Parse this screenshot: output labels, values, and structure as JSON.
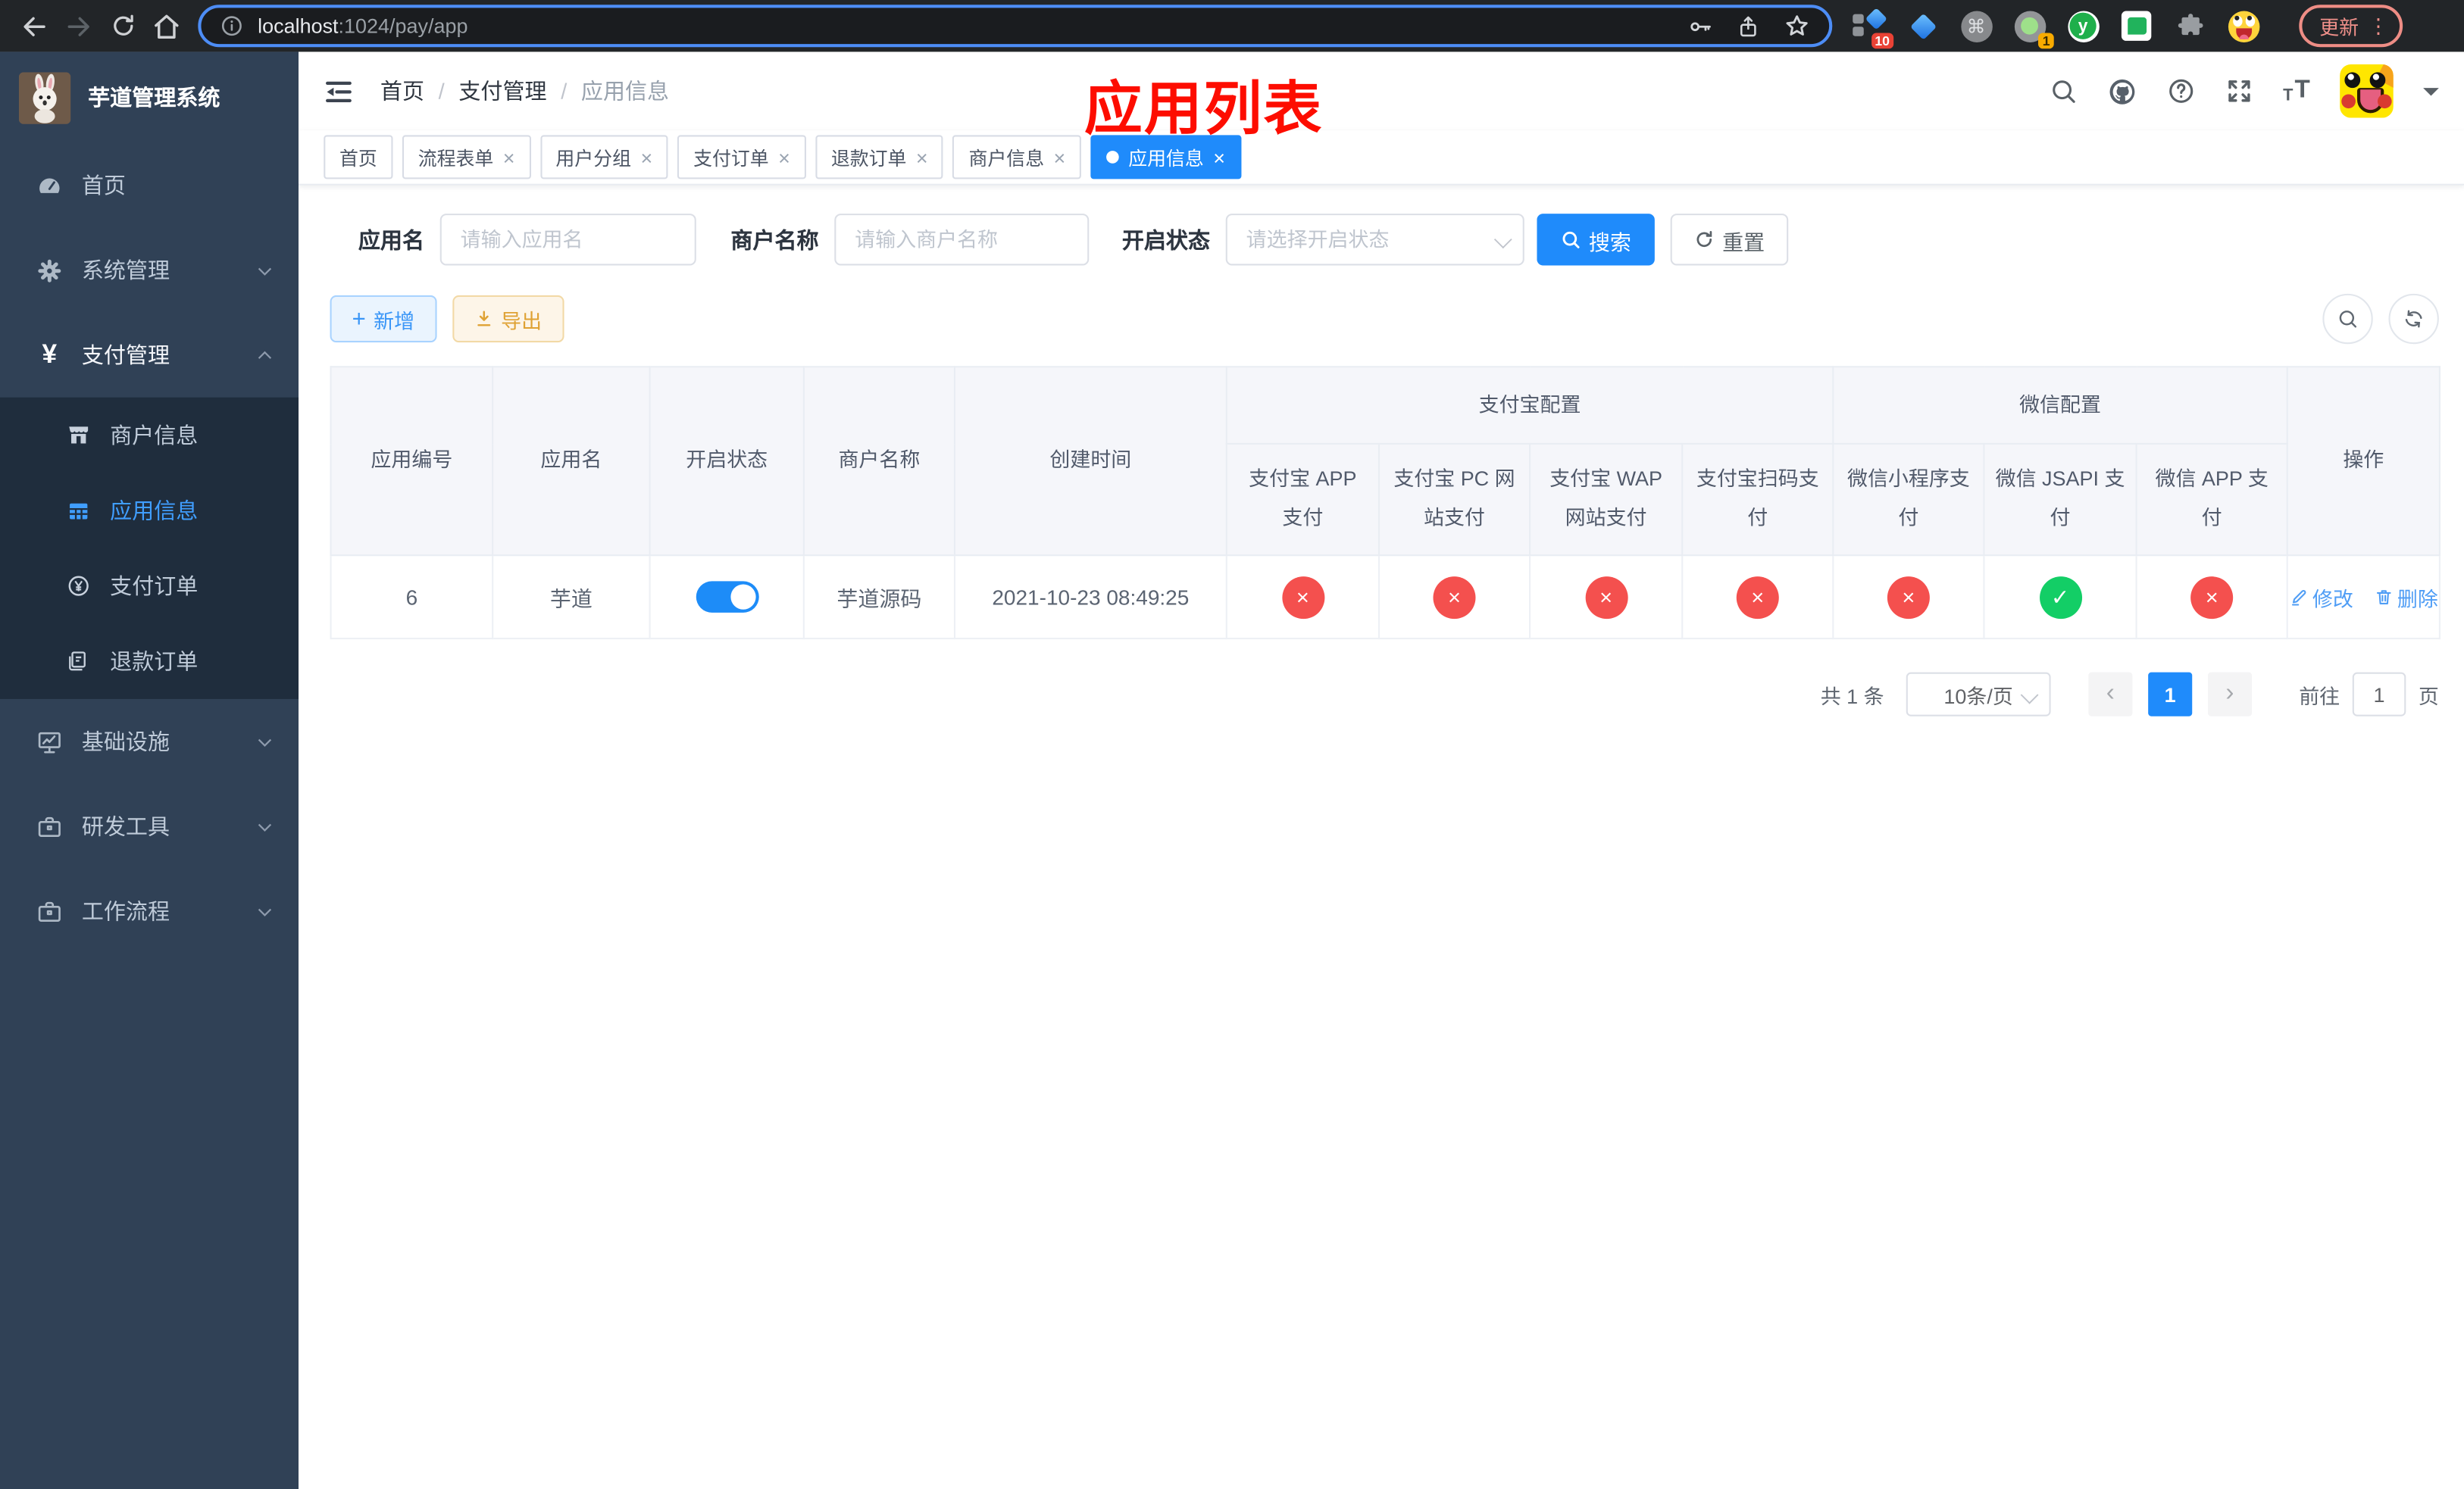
{
  "browser": {
    "url": {
      "host": "localhost",
      "path": ":1024/pay/app"
    },
    "update_label": "更新",
    "extensions": {
      "badge_blue": "10",
      "badge_circle": "1",
      "y_letter": "y"
    }
  },
  "sidebar": {
    "title": "芋道管理系统",
    "menu": [
      {
        "label": "首页"
      },
      {
        "label": "系统管理"
      },
      {
        "label": "支付管理"
      },
      {
        "label": "商户信息"
      },
      {
        "label": "应用信息"
      },
      {
        "label": "支付订单"
      },
      {
        "label": "退款订单"
      },
      {
        "label": "基础设施"
      },
      {
        "label": "研发工具"
      },
      {
        "label": "工作流程"
      }
    ]
  },
  "header": {
    "breadcrumb": [
      "首页",
      "支付管理",
      "应用信息"
    ],
    "separator": "/",
    "annotation": "应用列表"
  },
  "tabs": [
    {
      "label": "首页",
      "closable": false,
      "active": false
    },
    {
      "label": "流程表单",
      "closable": true,
      "active": false
    },
    {
      "label": "用户分组",
      "closable": true,
      "active": false
    },
    {
      "label": "支付订单",
      "closable": true,
      "active": false
    },
    {
      "label": "退款订单",
      "closable": true,
      "active": false
    },
    {
      "label": "商户信息",
      "closable": true,
      "active": false
    },
    {
      "label": "应用信息",
      "closable": true,
      "active": true
    }
  ],
  "filters": {
    "app_name_label": "应用名",
    "app_name_placeholder": "请输入应用名",
    "merchant_label": "商户名称",
    "merchant_placeholder": "请输入商户名称",
    "status_label": "开启状态",
    "status_placeholder": "请选择开启状态",
    "search_label": "搜索",
    "reset_label": "重置"
  },
  "toolbar": {
    "add_label": "新增",
    "export_label": "导出"
  },
  "table": {
    "columns": {
      "app_id": "应用编号",
      "app_name": "应用名",
      "open_status": "开启状态",
      "merchant_name": "商户名称",
      "create_time": "创建时间",
      "alipay_group": "支付宝配置",
      "wechat_group": "微信配置",
      "operation": "操作",
      "alipay_app": "支付宝 APP 支付",
      "alipay_pc": "支付宝 PC 网站支付",
      "alipay_wap": "支付宝 WAP 网站支付",
      "alipay_qr": "支付宝扫码支付",
      "wx_lite": "微信小程序支付",
      "wx_jsapi": "微信 JSAPI 支付",
      "wx_app": "微信 APP 支付"
    },
    "row": {
      "app_id": "6",
      "app_name": "芋道",
      "enabled": true,
      "merchant_name": "芋道源码",
      "create_time": "2021-10-23 08:49:25",
      "statuses": [
        "cross",
        "cross",
        "cross",
        "cross",
        "cross",
        "check",
        "cross"
      ],
      "edit_label": "修改",
      "delete_label": "删除"
    }
  },
  "pagination": {
    "total": "共 1 条",
    "page_size": "10条/页",
    "page": "1",
    "goto_prefix": "前往",
    "goto_value": "1",
    "goto_suffix": "页"
  },
  "colors": {
    "primary": "#1f8bfb",
    "link": "#4f9df5",
    "success": "#13ce66",
    "danger": "#f4504e",
    "sidebar": "#304156"
  }
}
